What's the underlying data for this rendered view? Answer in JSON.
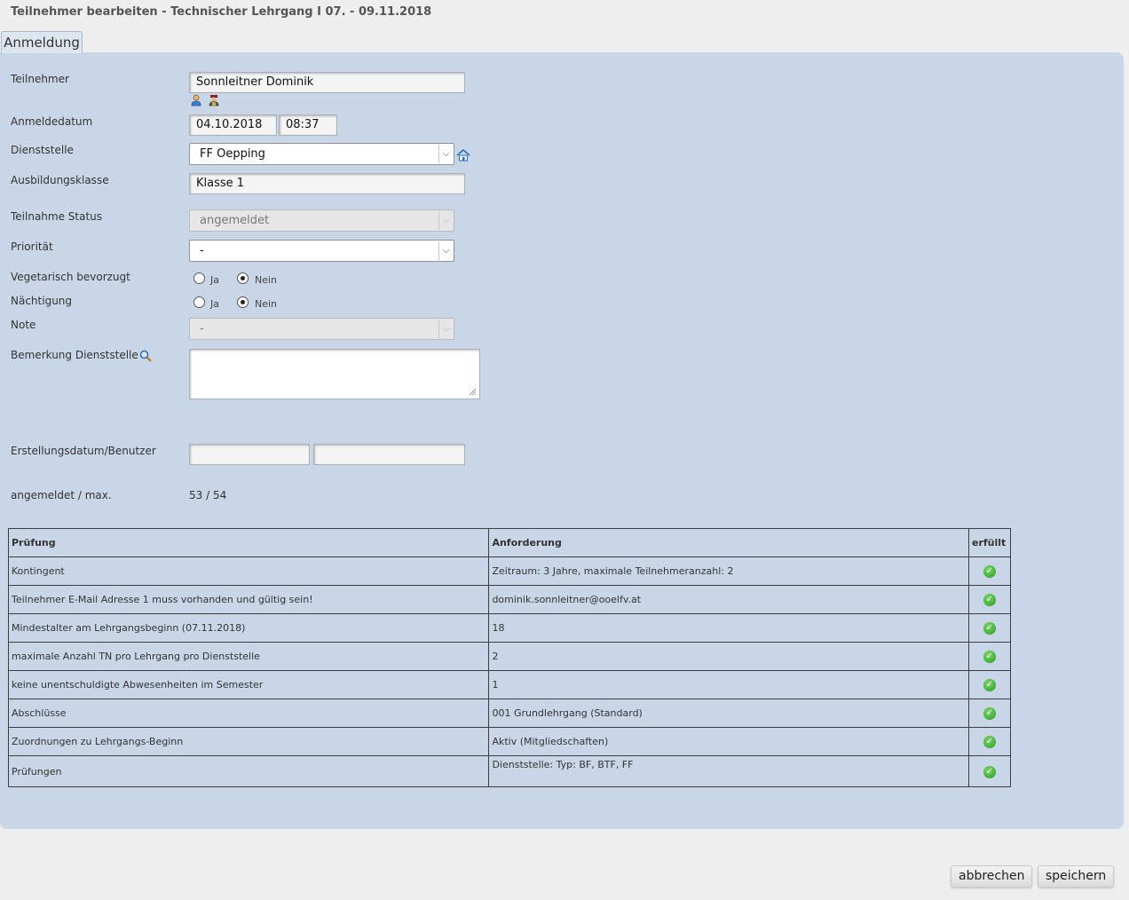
{
  "window": {
    "title": "Teilnehmer bearbeiten - Technischer Lehrgang I 07. - 09.11.2018"
  },
  "tabs": [
    {
      "label": "Anmeldung"
    }
  ],
  "form": {
    "teilnehmer": {
      "label": "Teilnehmer",
      "value": "Sonnleitner Dominik"
    },
    "anmeldedatum": {
      "label": "Anmeldedatum",
      "date": "04.10.2018",
      "time": "08:37"
    },
    "dienststelle": {
      "label": "Dienststelle",
      "value": "FF Oepping"
    },
    "ausbildungsklasse": {
      "label": "Ausbildungsklasse",
      "value": "Klasse 1"
    },
    "teilnahme_status": {
      "label": "Teilnahme Status",
      "value": "angemeldet"
    },
    "prioritaet": {
      "label": "Priorität",
      "value": "-"
    },
    "vegetarisch": {
      "label": "Vegetarisch bevorzugt",
      "option_yes": "Ja",
      "option_no": "Nein",
      "selected": "Nein"
    },
    "naechtigung": {
      "label": "Nächtigung",
      "option_yes": "Ja",
      "option_no": "Nein",
      "selected": "Nein"
    },
    "note": {
      "label": "Note",
      "value": "-"
    },
    "bemerkung": {
      "label": "Bemerkung Dienststelle",
      "value": ""
    },
    "erstellung": {
      "label": "Erstellungsdatum/Benutzer",
      "date": "",
      "user": ""
    },
    "angemeldet_max": {
      "label": "angemeldet / max.",
      "value": "53 / 54"
    }
  },
  "checks_table": {
    "headers": [
      "Prüfung",
      "Anforderung",
      "erfüllt"
    ],
    "rows": [
      {
        "pruefung": "Kontingent",
        "anforderung": "Zeitraum: 3 Jahre, maximale Teilnehmeranzahl: 2"
      },
      {
        "pruefung": "Teilnehmer E-Mail Adresse 1 muss vorhanden und gültig sein!",
        "anforderung": "dominik.sonnleitner@ooelfv.at"
      },
      {
        "pruefung": "Mindestalter am Lehrgangsbeginn (07.11.2018)",
        "anforderung": "18"
      },
      {
        "pruefung": "maximale Anzahl TN pro Lehrgang pro Dienststelle",
        "anforderung": "2"
      },
      {
        "pruefung": "keine unentschuldigte Abwesenheiten im Semester",
        "anforderung": "1"
      },
      {
        "pruefung": "Abschlüsse",
        "anforderung": "001 Grundlehrgang (Standard)"
      },
      {
        "pruefung": "Zuordnungen zu Lehrgangs-Beginn",
        "anforderung": "Aktiv (Mitgliedschaften)"
      },
      {
        "pruefung": "Prüfungen",
        "anforderung": "Dienststelle: Typ: BF, BTF, FF"
      }
    ]
  },
  "buttons": {
    "cancel": "abbrechen",
    "save": "speichern"
  },
  "icons": [
    "person-search-icon",
    "firefighter-icon",
    "home-location-icon",
    "magnifier-icon",
    "check-ok-icon"
  ],
  "colors": {
    "panel": "#c9d6e7",
    "background": "#eeeeee",
    "ok_green": "#1f9a1f"
  }
}
